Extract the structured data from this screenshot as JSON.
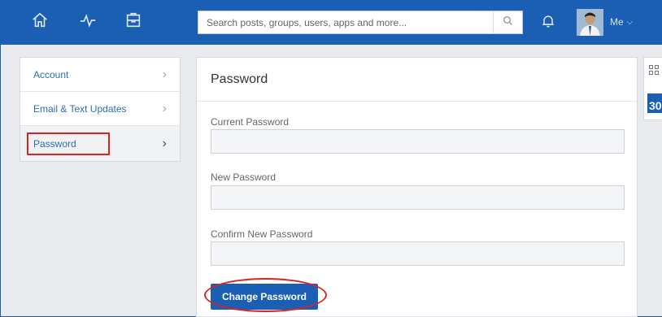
{
  "search": {
    "placeholder": "Search posts, groups, users, apps and more..."
  },
  "user": {
    "label": "Me"
  },
  "sidebar": {
    "items": [
      {
        "label": "Account"
      },
      {
        "label": "Email & Text Updates"
      },
      {
        "label": "Password"
      }
    ]
  },
  "main": {
    "title": "Password",
    "fields": [
      {
        "label": "Current Password",
        "value": ""
      },
      {
        "label": "New Password",
        "value": ""
      },
      {
        "label": "Confirm New Password",
        "value": ""
      }
    ],
    "submit_label": "Change Password"
  },
  "rail": {
    "calendar_number": "30"
  },
  "colors": {
    "brand": "#1a5fb4",
    "annotation": "#d82424"
  }
}
